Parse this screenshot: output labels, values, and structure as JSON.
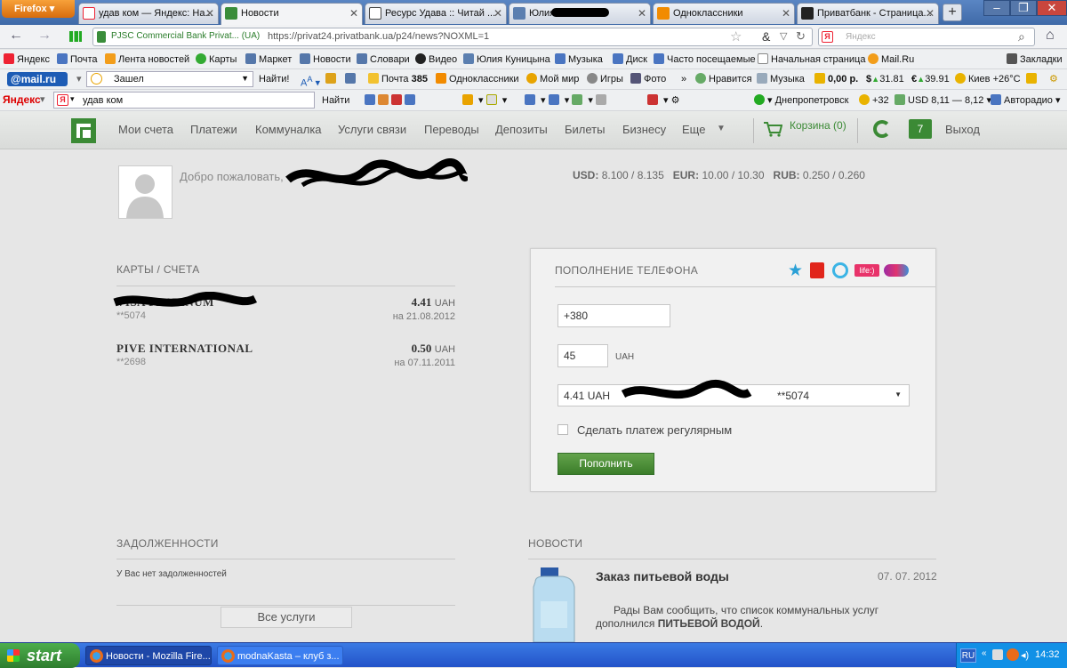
{
  "browser": {
    "firefox_btn": "Firefox",
    "tabs": [
      {
        "title": "удав ком — Яндекс: На...",
        "icon_color": "#e23"
      },
      {
        "title": "Новости",
        "icon_color": "#3a8d3a"
      },
      {
        "title": "Ресурс Удава :: Читай ...",
        "icon_color": "#444"
      },
      {
        "title": "Юлия",
        "icon_color": "#5b7fb0"
      },
      {
        "title": "Одноклассники",
        "icon_color": "#f28b00"
      },
      {
        "title": "Приватбанк - Страница...",
        "icon_color": "#222"
      }
    ],
    "new_tab": "+",
    "url_site_label": "PJSC Commercial Bank Privat... (UA)",
    "url": "https://privat24.privatbank.ua/p24/news?NOXML=1",
    "search_placeholder": "Яндекс",
    "bookmarks": [
      "Яндекс",
      "Почта",
      "Лента новостей",
      "Карты",
      "Маркет",
      "Новости",
      "Словари",
      "Видео",
      "Юлия Куницына",
      "Музыка",
      "Диск",
      "Часто посещаемые",
      "Начальная страница",
      "Mail.Ru",
      "Закладки"
    ],
    "mail_toolbar": {
      "logo": "@mail.ru",
      "search_value": "Зашел",
      "find": "Найти!",
      "pochta": "Почта",
      "pochta_count": "385",
      "odnoklassniki": "Одноклассники",
      "moi_mir": "Мой мир",
      "igry": "Игры",
      "foto": "Фото",
      "nravitsya": "Нравится",
      "muzyka": "Музыка",
      "money": "0,00 р.",
      "usd": "31.81",
      "eur": "39.91",
      "weather": "Киев +26°C"
    },
    "yandex_toolbar": {
      "logo": "Яндекс",
      "search_value": "удав ком",
      "find": "Найти",
      "city": "Днепропетровск",
      "temp": "+32",
      "usd_rate": "USD 8,11 — 8,12",
      "radio": "Авторадио"
    }
  },
  "site": {
    "nav": [
      "Мои счета",
      "Платежи",
      "Коммуналка",
      "Услуги связи",
      "Переводы",
      "Депозиты",
      "Билеты",
      "Бизнесу",
      "Еще"
    ],
    "cart": "Корзина (0)",
    "messages_count": "7",
    "logout": "Выход",
    "welcome": "Добро пожаловать,",
    "rates": {
      "usd_label": "USD:",
      "usd": "8.100 / 8.135",
      "eur_label": "EUR:",
      "eur": "10.00 / 10.30",
      "rub_label": "RUB:",
      "rub": "0.250 / 0.260"
    },
    "cards_title": "КАРТЫ / СЧЕТА",
    "cards": [
      {
        "name": "VISA PLATINUM",
        "number": "**5074",
        "amount": "4.41",
        "currency": "UAH",
        "date": "на 21.08.2012"
      },
      {
        "name": "PIVE INTERNATIONAL",
        "number": "**2698",
        "amount": "0.50",
        "currency": "UAH",
        "date": "на 07.11.2011"
      }
    ],
    "topup": {
      "title": "ПОПОЛНЕНИЕ ТЕЛЕФОНА",
      "operators": [
        "kyivstar",
        "mts",
        "beeline",
        "life",
        "utel"
      ],
      "phone_value": "+380",
      "amount_value": "45",
      "currency": "UAH",
      "card_select": "4.41 UAH",
      "card_select_suffix": "**5074",
      "regular_label": "Сделать платеж регулярным",
      "submit": "Пополнить"
    },
    "debts_title": "ЗАДОЛЖЕННОСТИ",
    "debts_text": "У Вас нет задолженностей",
    "all_services": "Все услуги",
    "news_title": "НОВОСТИ",
    "news": {
      "headline": "Заказ питьевой воды",
      "date": "07. 07. 2012",
      "text_start": "Рады Вам сообщить, что список коммунальных услуг дополнился",
      "text_bold": "ПИТЬЕВОЙ ВОДОЙ",
      "text_end": "."
    }
  },
  "taskbar": {
    "start": "start",
    "items": [
      "Новости - Mozilla Fire...",
      "modnaKasta – клуб з..."
    ],
    "lang": "RU",
    "time": "14:32"
  }
}
